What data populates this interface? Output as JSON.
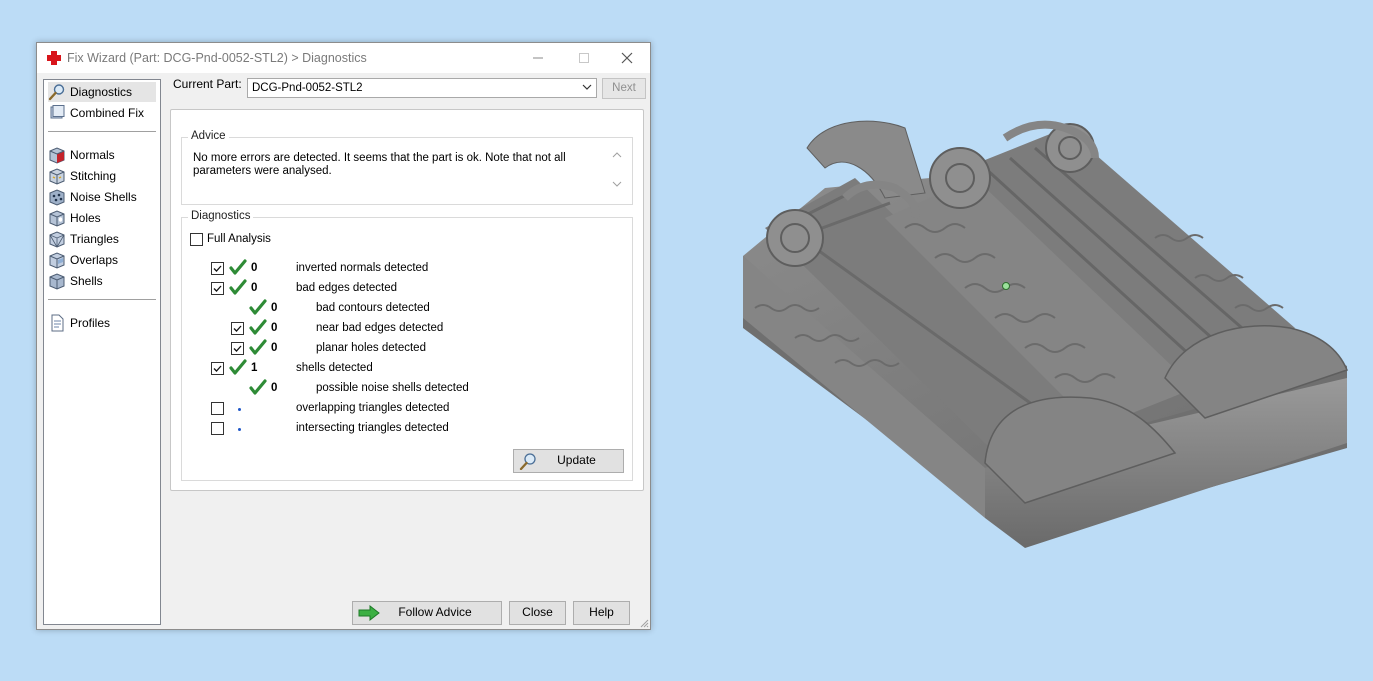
{
  "window": {
    "title": "Fix Wizard (Part: DCG-Pnd-0052-STL2) > Diagnostics"
  },
  "sidebar": {
    "items": [
      {
        "label": "Diagnostics",
        "icon": "magnifier-icon",
        "selected": true
      },
      {
        "label": "Combined Fix",
        "icon": "combined-fix-icon"
      },
      {
        "label": "Normals",
        "icon": "normals-cube-icon"
      },
      {
        "label": "Stitching",
        "icon": "stitching-cube-icon"
      },
      {
        "label": "Noise Shells",
        "icon": "noise-shells-icon"
      },
      {
        "label": "Holes",
        "icon": "holes-cube-icon"
      },
      {
        "label": "Triangles",
        "icon": "triangles-cube-icon"
      },
      {
        "label": "Overlaps",
        "icon": "overlaps-cube-icon"
      },
      {
        "label": "Shells",
        "icon": "shells-cube-icon"
      },
      {
        "label": "Profiles",
        "icon": "profiles-document-icon"
      }
    ]
  },
  "current_part": {
    "label": "Current Part:",
    "value": "DCG-Pnd-0052-STL2",
    "next_label": "Next"
  },
  "advice": {
    "title": "Advice",
    "text": "No more errors are detected. It seems that the part is ok. Note that not all parameters were analysed."
  },
  "diagnostics": {
    "title": "Diagnostics",
    "full_analysis_label": "Full Analysis",
    "full_analysis_checked": false,
    "rows": [
      {
        "checkbox": true,
        "checked": true,
        "status": "ok",
        "count": "0",
        "label": "inverted normals detected"
      },
      {
        "checkbox": true,
        "checked": true,
        "status": "ok",
        "count": "0",
        "label": "bad edges detected"
      },
      {
        "checkbox": false,
        "status": "ok",
        "count": "0",
        "label": "bad contours detected"
      },
      {
        "checkbox": true,
        "checked": true,
        "status": "ok",
        "count": "0",
        "label": "near bad edges detected"
      },
      {
        "checkbox": true,
        "checked": true,
        "status": "ok",
        "count": "0",
        "label": "planar holes detected"
      },
      {
        "checkbox": true,
        "checked": true,
        "status": "ok",
        "count": "1",
        "label": "shells detected"
      },
      {
        "checkbox": false,
        "status": "ok",
        "count": "0",
        "label": "possible noise shells detected"
      },
      {
        "checkbox": true,
        "checked": false,
        "status": "none",
        "count": "",
        "label": "overlapping triangles detected"
      },
      {
        "checkbox": true,
        "checked": false,
        "status": "none",
        "count": "",
        "label": "intersecting triangles detected"
      }
    ],
    "update_label": "Update"
  },
  "footer": {
    "follow_advice_label": "Follow Advice",
    "close_label": "Close",
    "help_label": "Help"
  },
  "colors": {
    "background": "#bcdcf6",
    "check_green": "#2e8b36",
    "arrow_green": "#3cb043",
    "model_gray": "#7d7d7d"
  }
}
